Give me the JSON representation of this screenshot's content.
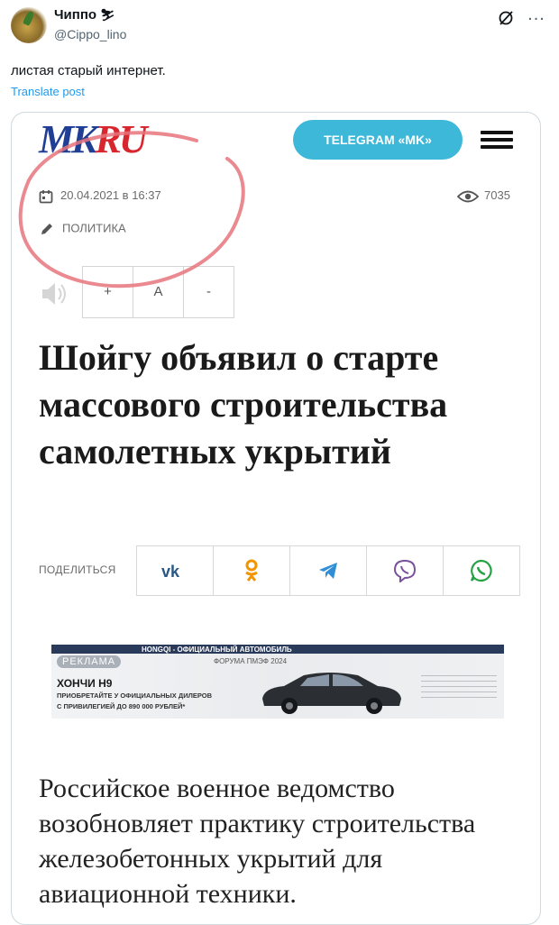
{
  "tweet": {
    "author_name": "Чиппо",
    "author_handle": "@Cippo_lino",
    "text": "листая старый интернет.",
    "translate_label": "Translate post"
  },
  "article": {
    "logo": {
      "part1": "MK",
      "part2": "RU"
    },
    "telegram_button": "TELEGRAM «MK»",
    "date": "20.04.2021 в 16:37",
    "views": "7035",
    "category": "ПОЛИТИКА",
    "font_controls": [
      "+",
      "A",
      "-"
    ],
    "headline": "Шойгу объявил о старте массового строительства самолетных укрытий",
    "share_label": "ПОДЕЛИТЬСЯ",
    "share_icons": [
      "vk-icon",
      "odnoklassniki-icon",
      "telegram-icon",
      "viber-icon",
      "whatsapp-icon"
    ],
    "ad": {
      "badge": "РЕКЛАМА",
      "headline": "HONGQI - ОФИЦИАЛЬНЫЙ АВТОМОБИЛЬ",
      "sub": "ФОРУМА ПМЭФ 2024",
      "model": "ХОНЧИ Н9",
      "line1": "ПРИОБРЕТАЙТЕ У ОФИЦИАЛЬНЫХ ДИЛЕРОВ",
      "line2": "С ПРИВИЛЕГИЕЙ ДО 890 000 РУБЛЕЙ*"
    },
    "body": "Российское военное ведомство возобновляет практику строительства железобетонных укрытий для авиационной техники."
  },
  "colors": {
    "logo_blue": "#1f3e94",
    "logo_red": "#d7262e",
    "telegram_button": "#3db8d8",
    "annotation_circle": "#e8747c",
    "link_blue": "#1d9bf0"
  }
}
